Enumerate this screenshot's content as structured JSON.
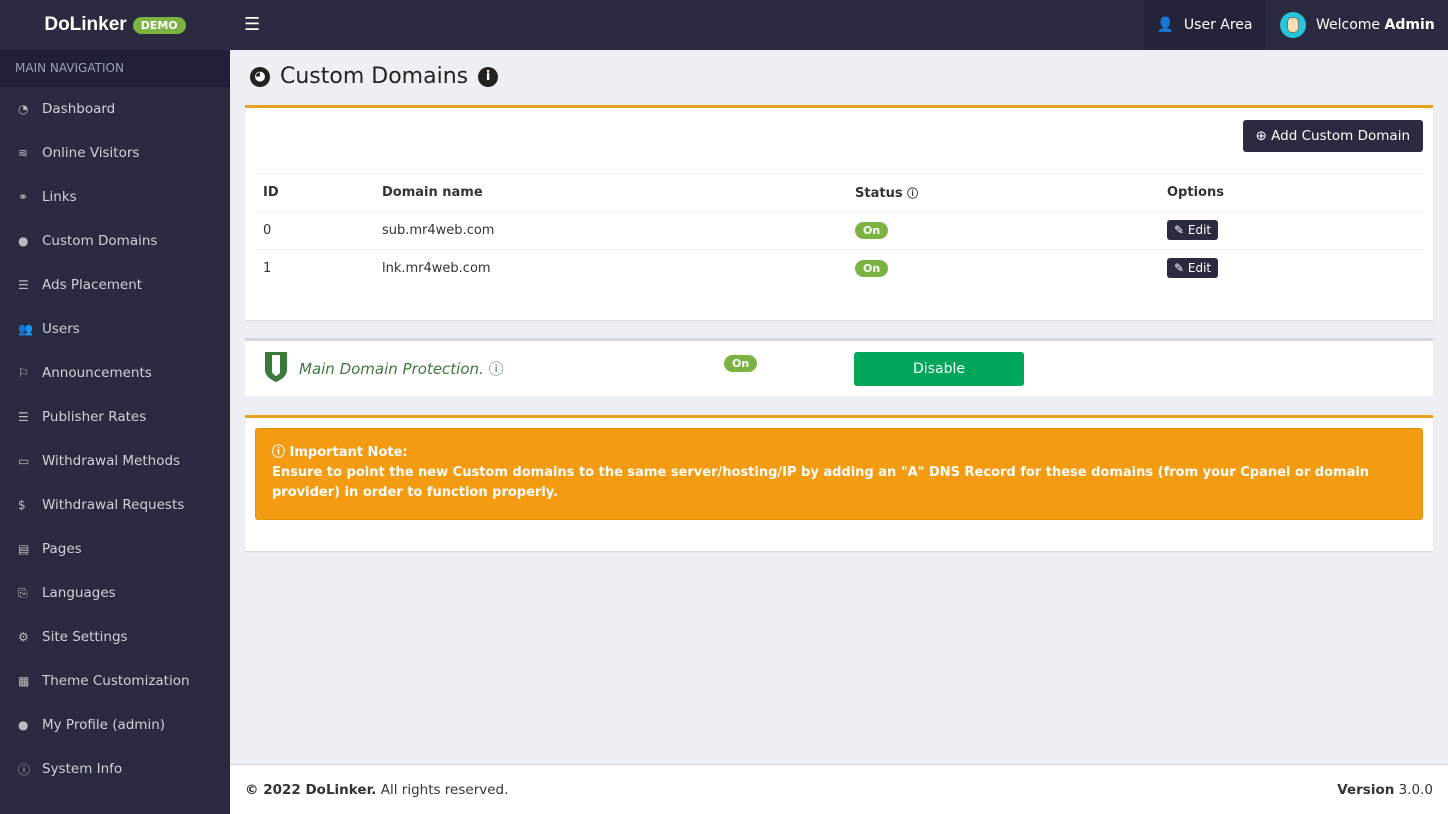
{
  "brand": {
    "name": "DoLinker",
    "badge": "DEMO"
  },
  "topbar": {
    "user_area": "User Area",
    "welcome": "Welcome",
    "user": "Admin"
  },
  "sidebar": {
    "header": "MAIN NAVIGATION",
    "items": [
      {
        "label": "Dashboard",
        "icon": "◔"
      },
      {
        "label": "Online Visitors",
        "icon": "≋"
      },
      {
        "label": "Links",
        "icon": "⚭"
      },
      {
        "label": "Custom Domains",
        "icon": "●"
      },
      {
        "label": "Ads Placement",
        "icon": "☰"
      },
      {
        "label": "Users",
        "icon": "👥"
      },
      {
        "label": "Announcements",
        "icon": "⚐"
      },
      {
        "label": "Publisher Rates",
        "icon": "☰"
      },
      {
        "label": "Withdrawal Methods",
        "icon": "▭"
      },
      {
        "label": "Withdrawal Requests",
        "icon": "$"
      },
      {
        "label": "Pages",
        "icon": "▤"
      },
      {
        "label": "Languages",
        "icon": "⎘"
      },
      {
        "label": "Site Settings",
        "icon": "⚙"
      },
      {
        "label": "Theme Customization",
        "icon": "▦"
      },
      {
        "label": "My Profile (admin)",
        "icon": "●"
      },
      {
        "label": "System Info",
        "icon": "ⓘ"
      }
    ]
  },
  "page": {
    "title": "Custom Domains",
    "add_button": "Add Custom Domain"
  },
  "table": {
    "headers": [
      "ID",
      "Domain name",
      "Status",
      "Options"
    ],
    "rows": [
      {
        "id": "0",
        "domain": "sub.mr4web.com",
        "status": "On",
        "option": "Edit"
      },
      {
        "id": "1",
        "domain": "lnk.mr4web.com",
        "status": "On",
        "option": "Edit"
      }
    ]
  },
  "protection": {
    "label": "Main Domain Protection.",
    "status": "On",
    "button": "Disable"
  },
  "note": {
    "title": "Important Note:",
    "text": "Ensure to point the new Custom domains to the same server/hosting/IP by adding an \"A\" DNS Record for these domains (from your Cpanel or domain provider) in order to function properly."
  },
  "footer": {
    "copyright": "© 2022 DoLinker.",
    "rights": "All rights reserved.",
    "version_label": "Version",
    "version": "3.0.0"
  }
}
